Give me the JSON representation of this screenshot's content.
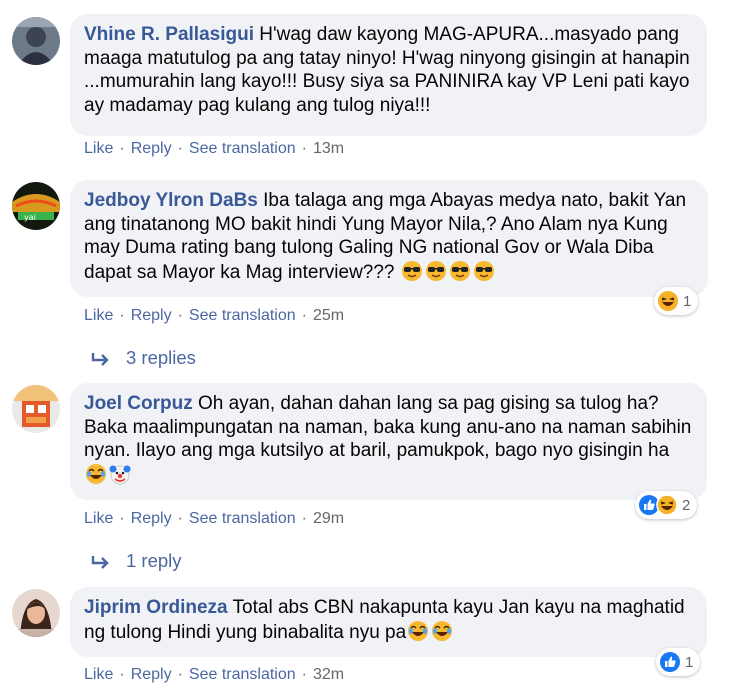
{
  "comments": [
    {
      "author": "Vhine R. Pallasigui",
      "text": "H'wag daw kayong MAG-APURA...masyado pang maaga matutulog pa ang tatay ninyo! H'wag ninyong gisingin at hanapin ...mumurahin lang kayo!!! Busy siya sa PANINIRA kay VP Leni pati kayo ay madamay pag kulang ang tulog niya!!!",
      "actions": {
        "like": "Like",
        "reply": "Reply",
        "translate": "See translation",
        "time": "13m"
      }
    },
    {
      "author": "Jedboy Ylron DaBs",
      "text": "Iba talaga ang mga Abayas medya nato, bakit Yan ang tinatanong MO bakit hindi Yung Mayor Nila,? Ano Alam nya Kung may Duma rating bang tulong Galing NG national Gov or Wala Diba dapat sa Mayor ka Mag interview???",
      "emojis": [
        "sunglasses-emoji",
        "sunglasses-emoji",
        "sunglasses-emoji",
        "sunglasses-emoji"
      ],
      "reaction_count": "1",
      "actions": {
        "like": "Like",
        "reply": "Reply",
        "translate": "See translation",
        "time": "25m"
      },
      "replies_label": "3 replies"
    },
    {
      "author": "Joel Corpuz",
      "text": "Oh ayan, dahan dahan lang sa pag gising sa tulog ha? Baka maalimpungatan na naman, baka kung anu-ano na naman sabihin nyan. Ilayo ang mga kutsilyo at baril, pamukpok, bago nyo gisingin ha",
      "emojis": [
        "laughing-emoji",
        "clown-emoji"
      ],
      "reaction_count": "2",
      "actions": {
        "like": "Like",
        "reply": "Reply",
        "translate": "See translation",
        "time": "29m"
      },
      "replies_label": "1 reply"
    },
    {
      "author": "Jiprim Ordineza",
      "text": "Total abs CBN nakapunta kayu Jan kayu na maghatid ng tulong Hindi yung binabalita nyu pa",
      "emojis": [
        "laughing-emoji",
        "laughing-emoji"
      ],
      "reaction_count": "1",
      "actions": {
        "like": "Like",
        "reply": "Reply",
        "translate": "See translation",
        "time": "32m"
      }
    }
  ],
  "colors": {
    "author": "#385898",
    "bubble": "#f0f2f5",
    "link": "#4b67a1",
    "meta": "#65676b",
    "like_blue": "#1877f2"
  }
}
